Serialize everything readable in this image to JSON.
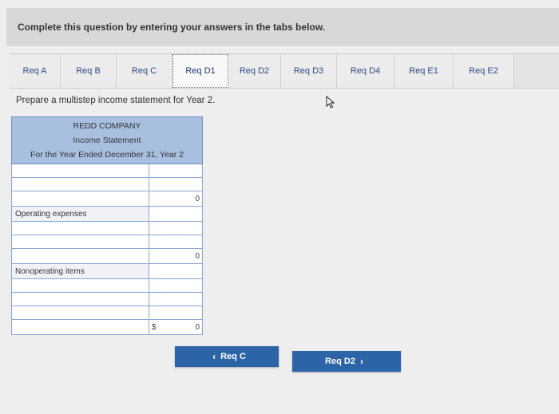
{
  "header": {
    "instruction": "Complete this question by entering your answers in the tabs below."
  },
  "tabs": [
    {
      "label": "Req A"
    },
    {
      "label": "Req B"
    },
    {
      "label": "Req C"
    },
    {
      "label": "Req D1"
    },
    {
      "label": "Req D2"
    },
    {
      "label": "Req D3"
    },
    {
      "label": "Req D4"
    },
    {
      "label": "Req E1"
    },
    {
      "label": "Req E2"
    }
  ],
  "active_tab": "Req D1",
  "prompt": "Prepare a multistep income statement for Year 2.",
  "statement": {
    "company": "REDD COMPANY",
    "title": "Income Statement",
    "period": "For the Year Ended December 31, Year 2",
    "operating_label": "Operating expenses",
    "nonoperating_label": "Nonoperating items",
    "subtotal_1": "0",
    "subtotal_2": "0",
    "total_symbol": "$",
    "total_value": "0"
  },
  "nav": {
    "prev_label": "Req C",
    "next_label": "Req D2"
  }
}
